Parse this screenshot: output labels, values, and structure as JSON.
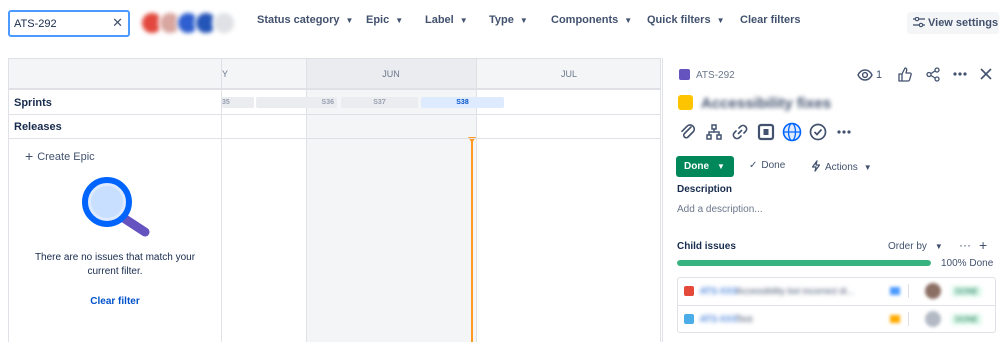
{
  "search": {
    "value": "ATS-292",
    "clear_icon": "close-icon"
  },
  "avatars": [
    {
      "name": "avatar-1",
      "color": "#e2483d"
    },
    {
      "name": "avatar-2",
      "color": "#d9a6a0"
    },
    {
      "name": "avatar-3",
      "color": "#2f5fd0"
    },
    {
      "name": "avatar-4",
      "color": "#2455b8"
    },
    {
      "name": "avatar-5",
      "color": "#dfe1e6"
    }
  ],
  "filters": {
    "status_category": "Status category",
    "epic": "Epic",
    "label": "Label",
    "type": "Type",
    "components": "Components",
    "quick_filters": "Quick filters",
    "clear_filters": "Clear filters",
    "view_settings": "View settings"
  },
  "timeline": {
    "months": [
      "Y",
      "JUN",
      "JUL"
    ],
    "rows": {
      "sprints": "Sprints",
      "releases": "Releases"
    },
    "sprints": [
      {
        "label": "35",
        "active": false
      },
      {
        "label": "S36",
        "active": false
      },
      {
        "label": "S37",
        "active": false
      },
      {
        "label": "S38",
        "active": true
      }
    ],
    "create_epic": "Create Epic",
    "empty_message": "There are no issues that match your current filter.",
    "clear_filter": "Clear filter"
  },
  "panel": {
    "issue_key": "ATS-292",
    "watch_count": "1",
    "title": "Accessibility fixes",
    "status": "Done",
    "resolution": "Done",
    "actions": "Actions",
    "description_label": "Description",
    "description_placeholder": "Add a description...",
    "child_issues_label": "Child issues",
    "order_by": "Order by",
    "progress": {
      "fraction": 1.0,
      "text": "100% Done"
    },
    "child_issues": [
      {
        "key": "ATS-XXX",
        "summary": "Accessibility bot incorrect di...",
        "type_color": "#e5493a",
        "priority_color": "#4c9aff",
        "avatar_color": "#8c6f64",
        "status": "DONE"
      },
      {
        "key": "ATS-XXX",
        "summary": "Test",
        "type_color": "#4bade8",
        "priority_color": "#ffab00",
        "avatar_color": "#b3bac5",
        "status": "DONE"
      }
    ]
  },
  "colors": {
    "accent": "#0052cc",
    "done_green": "#00875a",
    "progress_green": "#36b37e",
    "today_orange": "#ff991f",
    "epic_purple": "#6554c0",
    "title_yellow": "#ffc400"
  }
}
